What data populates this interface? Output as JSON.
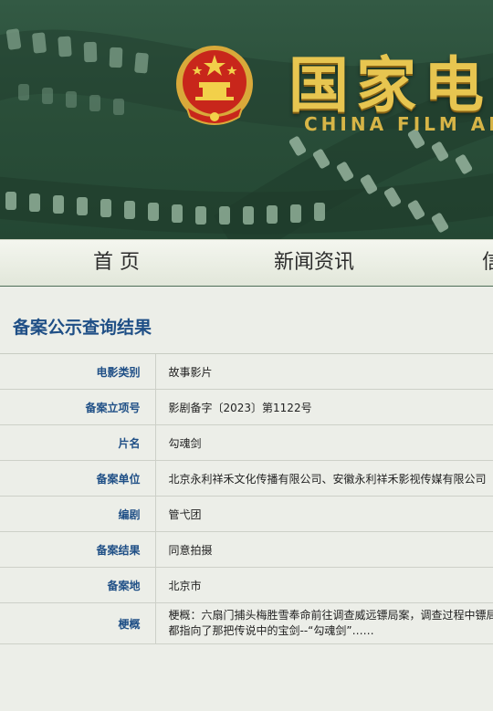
{
  "header": {
    "title": "国家电",
    "subtitle": "CHINA FILM AD",
    "emblem": "national-emblem"
  },
  "nav": {
    "items": [
      {
        "label": "首 页"
      },
      {
        "label": "新闻资讯"
      }
    ]
  },
  "section": {
    "title": "备案公示查询结果"
  },
  "record": [
    {
      "label": "电影类别",
      "value": "故事影片"
    },
    {
      "label": "备案立项号",
      "value": "影剧备字〔2023〕第1122号"
    },
    {
      "label": "片名",
      "value": "勾魂剑"
    },
    {
      "label": "备案单位",
      "value": "北京永利祥禾文化传播有限公司、安徽永利祥禾影视传媒有限公司"
    },
    {
      "label": "编剧",
      "value": "管弋团"
    },
    {
      "label": "备案结果",
      "value": "同意拍摄"
    },
    {
      "label": "备案地",
      "value": "北京市"
    }
  ],
  "synopsis": {
    "label": "梗概",
    "line1": "梗概：六扇门捕头梅胜雪奉命前往调查威远镖局案，调查过程中镖局竟",
    "line2": "都指向了那把传说中的宝剑--“勾魂剑”……"
  },
  "colors": {
    "banner": "#2a4e39",
    "gold": "#e7c550",
    "label_blue": "#1f4f86",
    "emblem_red": "#c8261b"
  }
}
